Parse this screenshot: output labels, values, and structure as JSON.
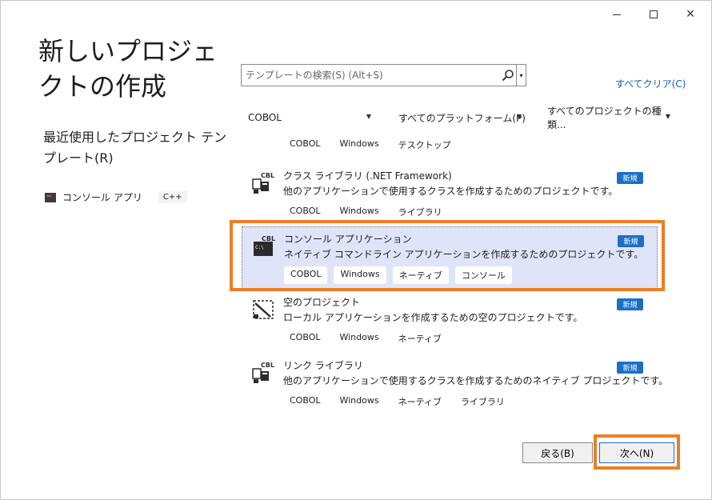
{
  "window": {
    "min_label": "",
    "max_label": "",
    "close_label": "✕"
  },
  "title": "新しいプロジェクトの作成",
  "recent": {
    "heading": "最近使用したプロジェクト テンプレート(R)",
    "items": [
      {
        "label": "コンソール アプリ",
        "tag": "C++"
      }
    ]
  },
  "search": {
    "placeholder": "テンプレートの検索(S) (Alt+S)",
    "value": ""
  },
  "clear_all": "すべてクリア(C)",
  "filters": {
    "language": "COBOL",
    "platform": "すべてのプラットフォーム(P)",
    "project_type": "すべてのプロジェクトの種類..."
  },
  "top_tags": [
    "COBOL",
    "Windows",
    "テスクトップ"
  ],
  "templates": [
    {
      "name": "クラス ライブラリ (.NET Framework)",
      "description": "他のアプリケーションで使用するクラスを作成するためのプロジェクトです。",
      "badge": "新規",
      "tags": [
        "COBOL",
        "Windows",
        "ライブラリ"
      ],
      "icon": "class-library-icon"
    },
    {
      "name": "コンソール アプリケーション",
      "description": "ネイティブ コマンドライン アプリケーションを作成するためのプロジェクトです。",
      "badge": "新規",
      "tags": [
        "COBOL",
        "Windows",
        "ネーティブ",
        "コンソール"
      ],
      "icon": "console-app-icon"
    },
    {
      "name": "空のプロジェクト",
      "description": "ローカル アプリケーションを作成するための空のプロジェクトです。",
      "badge": "新規",
      "tags": [
        "COBOL",
        "Windows",
        "ネーティブ"
      ],
      "icon": "empty-project-icon"
    },
    {
      "name": "リンク ライブラリ",
      "description": "他のアプリケーションで使用するクラスを作成するためのネイティブ プロジェクトです。",
      "badge": "新規",
      "tags": [
        "COBOL",
        "Windows",
        "ネーティブ",
        "ライブラリ"
      ],
      "icon": "link-library-icon"
    }
  ],
  "buttons": {
    "back": "戻る(B)",
    "next": "次へ(N)"
  },
  "colors": {
    "accent": "#1b6fc7",
    "highlight": "#ee7d22",
    "selected_bg": "#dfe4f8"
  }
}
